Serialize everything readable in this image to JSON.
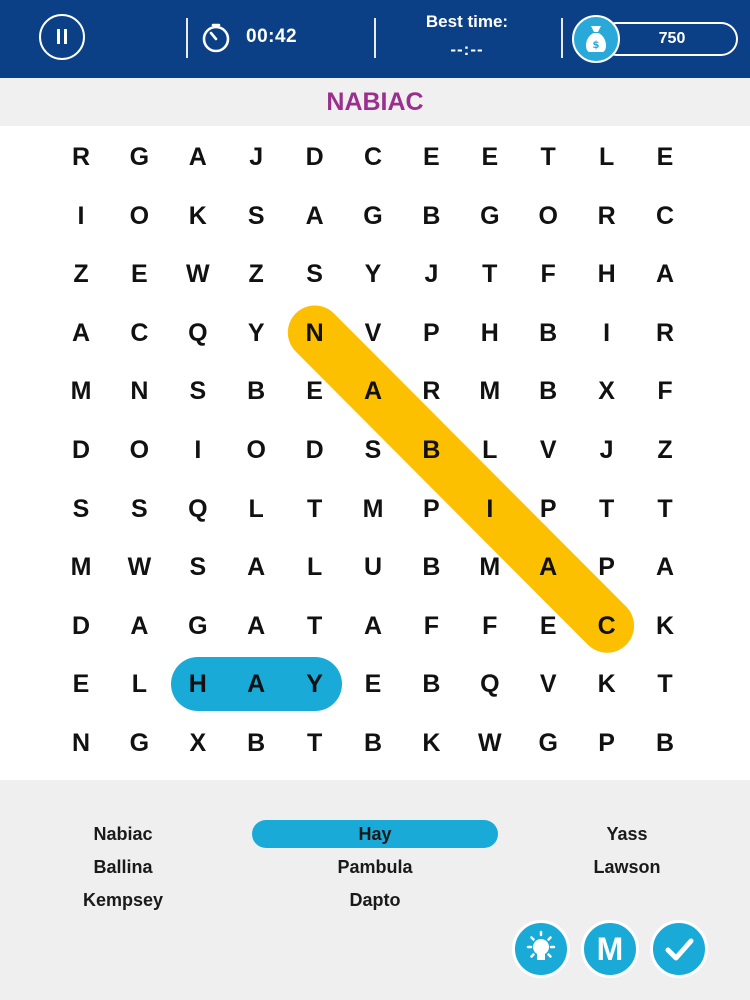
{
  "header": {
    "timer": "00:42",
    "best_time_label": "Best time:",
    "best_time_value": "--:--",
    "coins": "750"
  },
  "target_word": "NABIAC",
  "grid": [
    [
      "R",
      "G",
      "A",
      "J",
      "D",
      "C",
      "E",
      "E",
      "T",
      "L",
      "E"
    ],
    [
      "I",
      "O",
      "K",
      "S",
      "A",
      "G",
      "B",
      "G",
      "O",
      "R",
      "C"
    ],
    [
      "Z",
      "E",
      "W",
      "Z",
      "S",
      "Y",
      "J",
      "T",
      "F",
      "H",
      "A"
    ],
    [
      "A",
      "C",
      "Q",
      "Y",
      "N",
      "V",
      "P",
      "H",
      "B",
      "I",
      "R"
    ],
    [
      "M",
      "N",
      "S",
      "B",
      "E",
      "A",
      "R",
      "M",
      "B",
      "X",
      "F"
    ],
    [
      "D",
      "O",
      "I",
      "O",
      "D",
      "S",
      "B",
      "L",
      "V",
      "J",
      "Z"
    ],
    [
      "S",
      "S",
      "Q",
      "L",
      "T",
      "M",
      "P",
      "I",
      "P",
      "T",
      "T"
    ],
    [
      "M",
      "W",
      "S",
      "A",
      "L",
      "U",
      "B",
      "M",
      "A",
      "P",
      "A"
    ],
    [
      "D",
      "A",
      "G",
      "A",
      "T",
      "A",
      "F",
      "F",
      "E",
      "C",
      "K"
    ],
    [
      "E",
      "L",
      "H",
      "A",
      "Y",
      "E",
      "B",
      "Q",
      "V",
      "K",
      "T"
    ],
    [
      "N",
      "G",
      "X",
      "B",
      "T",
      "B",
      "K",
      "W",
      "G",
      "P",
      "B"
    ]
  ],
  "highlights": [
    {
      "word": "NABIAC",
      "color": "#fcc000",
      "from": [
        3,
        4
      ],
      "to": [
        8,
        9
      ]
    },
    {
      "word": "HAY",
      "color": "#1aaad8",
      "from": [
        9,
        2
      ],
      "to": [
        9,
        4
      ]
    }
  ],
  "words": [
    {
      "label": "Nabiac"
    },
    {
      "label": "Hay",
      "found": true
    },
    {
      "label": "Yass"
    },
    {
      "label": "Ballina"
    },
    {
      "label": "Pambula"
    },
    {
      "label": "Lawson"
    },
    {
      "label": "Kempsey"
    },
    {
      "label": "Dapto"
    }
  ],
  "buttons": {
    "hint_icon": "lightbulb-icon",
    "m_label": "M",
    "confirm_icon": "check-icon"
  },
  "colors": {
    "header_bg": "#0b3f86",
    "target_word": "#9b2f8e",
    "accent_blue": "#1aaad8",
    "accent_yellow": "#fcc000"
  }
}
